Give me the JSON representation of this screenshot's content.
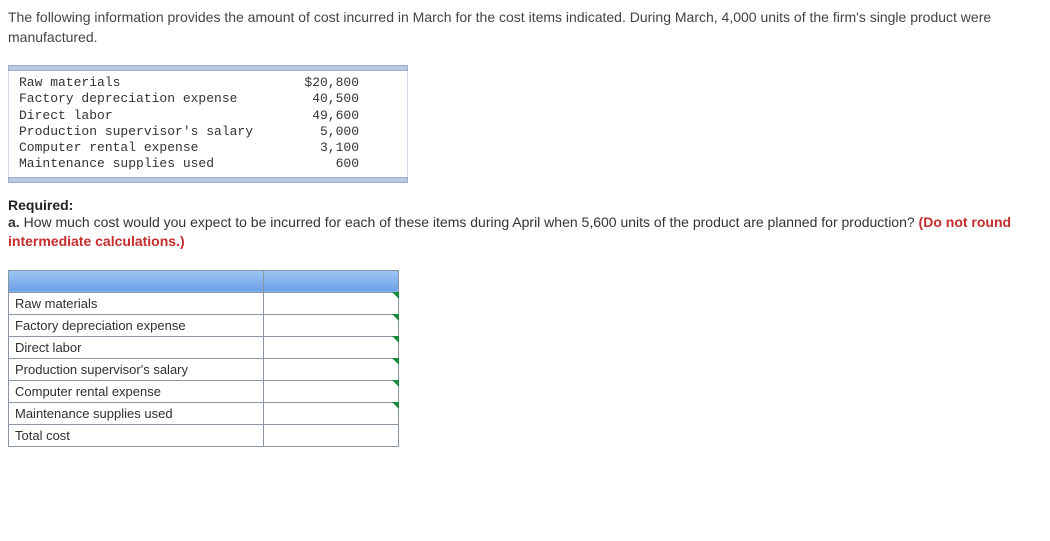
{
  "intro": "The following information provides the amount of cost incurred in March for the cost items indicated. During March, 4,000 units of the firm's single product were manufactured.",
  "march_data": [
    {
      "label": "Raw materials",
      "value": "$20,800"
    },
    {
      "label": "Factory depreciation expense",
      "value": "40,500"
    },
    {
      "label": "Direct labor",
      "value": "49,600"
    },
    {
      "label": "Production supervisor's salary",
      "value": "5,000"
    },
    {
      "label": "Computer rental expense",
      "value": "3,100"
    },
    {
      "label": "Maintenance supplies used",
      "value": "600"
    }
  ],
  "required": {
    "heading": "Required:",
    "part_label": "a.",
    "question": "How much cost would you expect to be incurred for each of these items during April when 5,600 units of the product are planned for production?",
    "note": "(Do not round intermediate calculations.)"
  },
  "answer_rows": [
    "Raw materials",
    "Factory depreciation expense",
    "Direct labor",
    "Production supervisor's salary",
    "Computer rental expense",
    "Maintenance supplies used",
    "Total cost"
  ]
}
